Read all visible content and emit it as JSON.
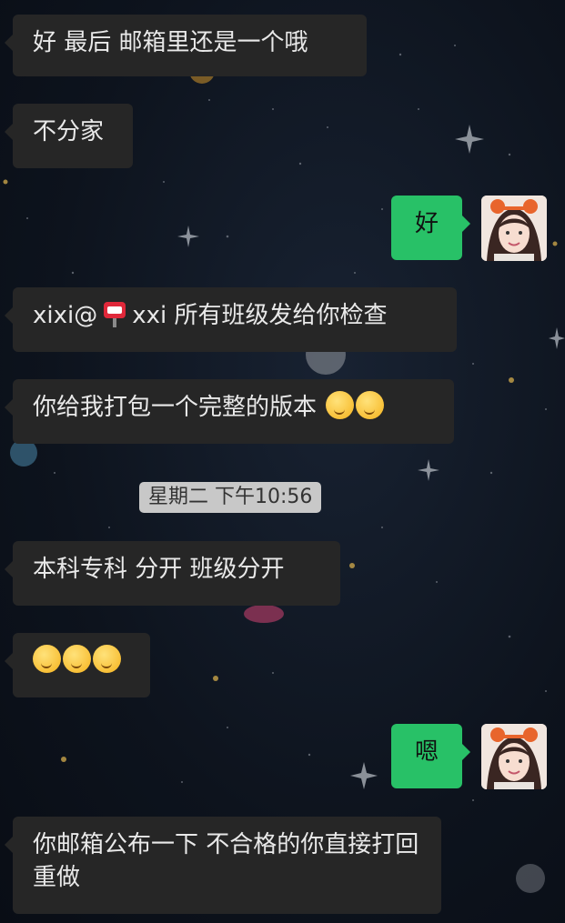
{
  "messages": [
    {
      "side": "left",
      "text": "好 最后 邮箱里还是一个哦"
    },
    {
      "side": "left",
      "text": "不分家"
    },
    {
      "side": "right",
      "text": "好",
      "avatar": "avatar-girl"
    },
    {
      "side": "left",
      "text_a": "xixi@",
      "icon": "mailbox-emoji",
      "text_b": "xxi  所有班级发给你检查"
    },
    {
      "side": "left",
      "text": "你给我打包一个完整的版本",
      "emojis": [
        "thinking-face-emoji",
        "smiling-face-emoji"
      ]
    },
    {
      "side": "left",
      "text": "本科专科 分开 班级分开"
    },
    {
      "side": "left",
      "emojis": [
        "kissing-face-emoji",
        "kissing-face-emoji",
        "kissing-face-emoji"
      ]
    },
    {
      "side": "right",
      "text": "嗯",
      "avatar": "avatar-girl"
    },
    {
      "side": "left",
      "text": "你邮箱公布一下 不合格的你直接打回重做"
    }
  ],
  "timestamp": "星期二 下午10:56",
  "colors": {
    "background": "#0e1420",
    "left_bubble": "#262626",
    "right_bubble": "#28c167",
    "timestamp_bg": "#c8c8c8"
  }
}
